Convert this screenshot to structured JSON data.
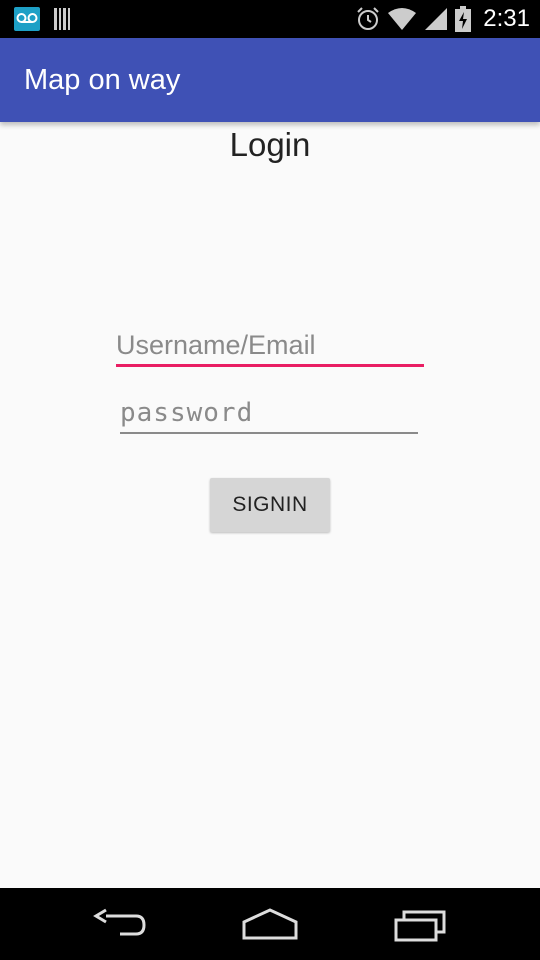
{
  "status_bar": {
    "time": "2:31",
    "icons": [
      "voicemail-icon",
      "barcode-icon",
      "alarm-icon",
      "wifi-icon",
      "signal-icon",
      "battery-charging-icon"
    ]
  },
  "app_bar": {
    "title": "Map on way"
  },
  "login": {
    "heading": "Login",
    "username": {
      "placeholder": "Username/Email",
      "value": ""
    },
    "password": {
      "placeholder": "password",
      "value": ""
    },
    "signin_label": "SIGNIN"
  },
  "colors": {
    "app_bar": "#3f51b5",
    "focused_underline": "#e91e63",
    "button_bg": "#d6d6d6",
    "voicemail_badge": "#1ea0c6"
  },
  "nav_bar": {
    "icons": [
      "back-icon",
      "home-icon",
      "recent-apps-icon"
    ]
  }
}
